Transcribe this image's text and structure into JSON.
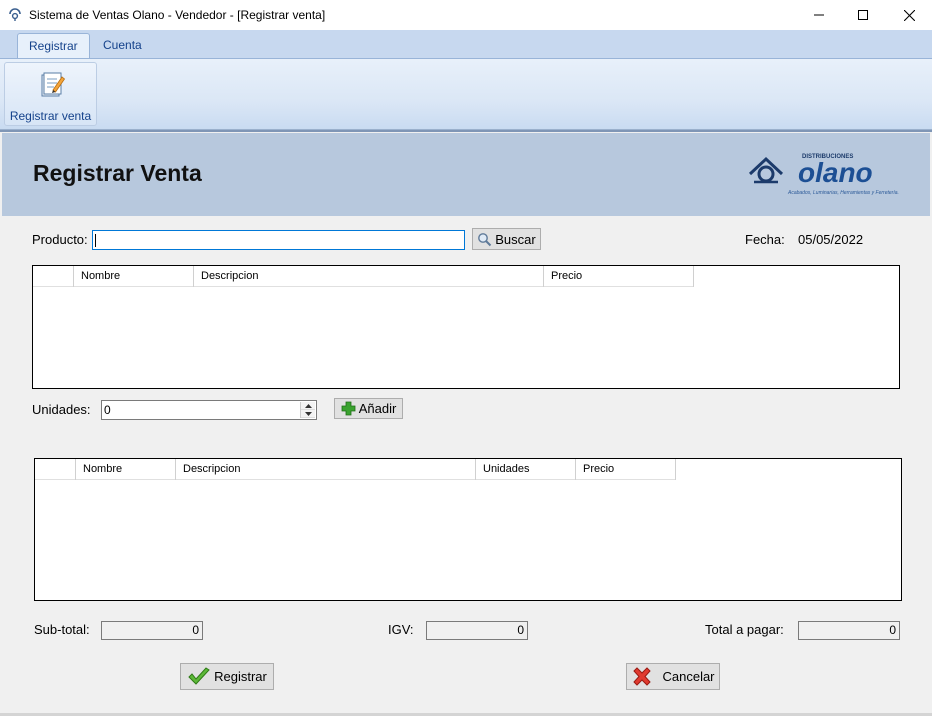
{
  "window": {
    "title": "Sistema de Ventas Olano - Vendedor - [Registrar venta]"
  },
  "ribbon": {
    "tabs": [
      "Registrar",
      "Cuenta"
    ],
    "active_tab": "Registrar",
    "button_label": "Registrar venta"
  },
  "header": {
    "title": "Registrar Venta",
    "logo_small": "DISTRIBUCIONES",
    "logo_big": "olano",
    "logo_tagline": "Acabados, Luminarias, Herramientas y Ferretería."
  },
  "search": {
    "label": "Producto:",
    "value": "",
    "button": "Buscar"
  },
  "fecha": {
    "label": "Fecha:",
    "value": "05/05/2022"
  },
  "products_grid": {
    "columns": [
      "",
      "Nombre",
      "Descripcion",
      "Precio"
    ],
    "rows": []
  },
  "units": {
    "label": "Unidades:",
    "value": "0",
    "add_button": "Añadir"
  },
  "cart_grid": {
    "columns": [
      "",
      "Nombre",
      "Descripcion",
      "Unidades",
      "Precio"
    ],
    "rows": []
  },
  "totals": {
    "subtotal_label": "Sub-total:",
    "subtotal_value": "0",
    "igv_label": "IGV:",
    "igv_value": "0",
    "total_label": "Total a pagar:",
    "total_value": "0"
  },
  "actions": {
    "register": "Registrar",
    "cancel": "Cancelar"
  }
}
